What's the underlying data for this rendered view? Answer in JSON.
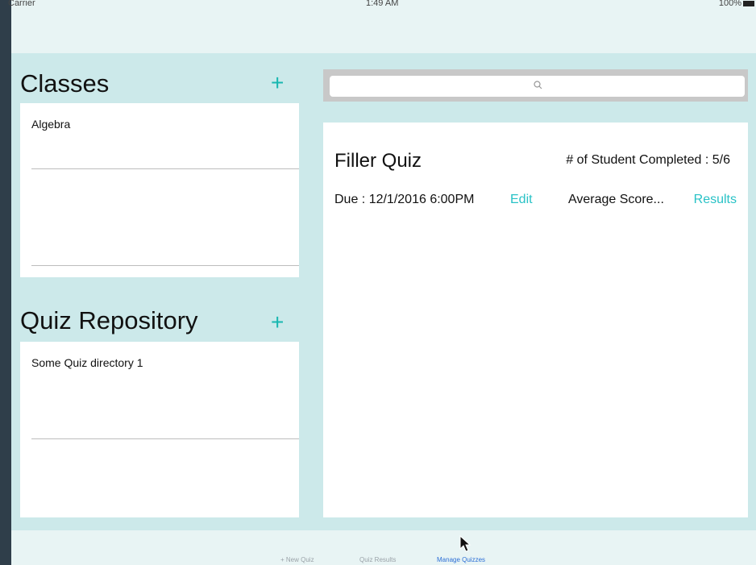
{
  "status_bar": {
    "carrier": "Carrier",
    "time": "1:49 AM",
    "battery": "100%"
  },
  "classes": {
    "title": "Classes",
    "add_label": "+",
    "items": [
      "Algebra"
    ]
  },
  "quiz_repository": {
    "title": "Quiz Repository",
    "add_label": "+",
    "items": [
      "Some Quiz directory 1"
    ]
  },
  "search": {
    "placeholder": ""
  },
  "quiz": {
    "title": "Filler Quiz",
    "completed": "# of Student Completed : 5/6",
    "due": "Due : 12/1/2016 6:00PM",
    "edit_label": "Edit",
    "average": "Average Score...",
    "results_label": "Results"
  },
  "tabs": [
    {
      "label": "+ New Quiz"
    },
    {
      "label": "Quiz Results"
    },
    {
      "label": "Manage Quizzes",
      "active": true
    }
  ],
  "colors": {
    "accent": "#18b7b0",
    "background": "#cce9ea",
    "active_tab": "#2d6fd6"
  }
}
